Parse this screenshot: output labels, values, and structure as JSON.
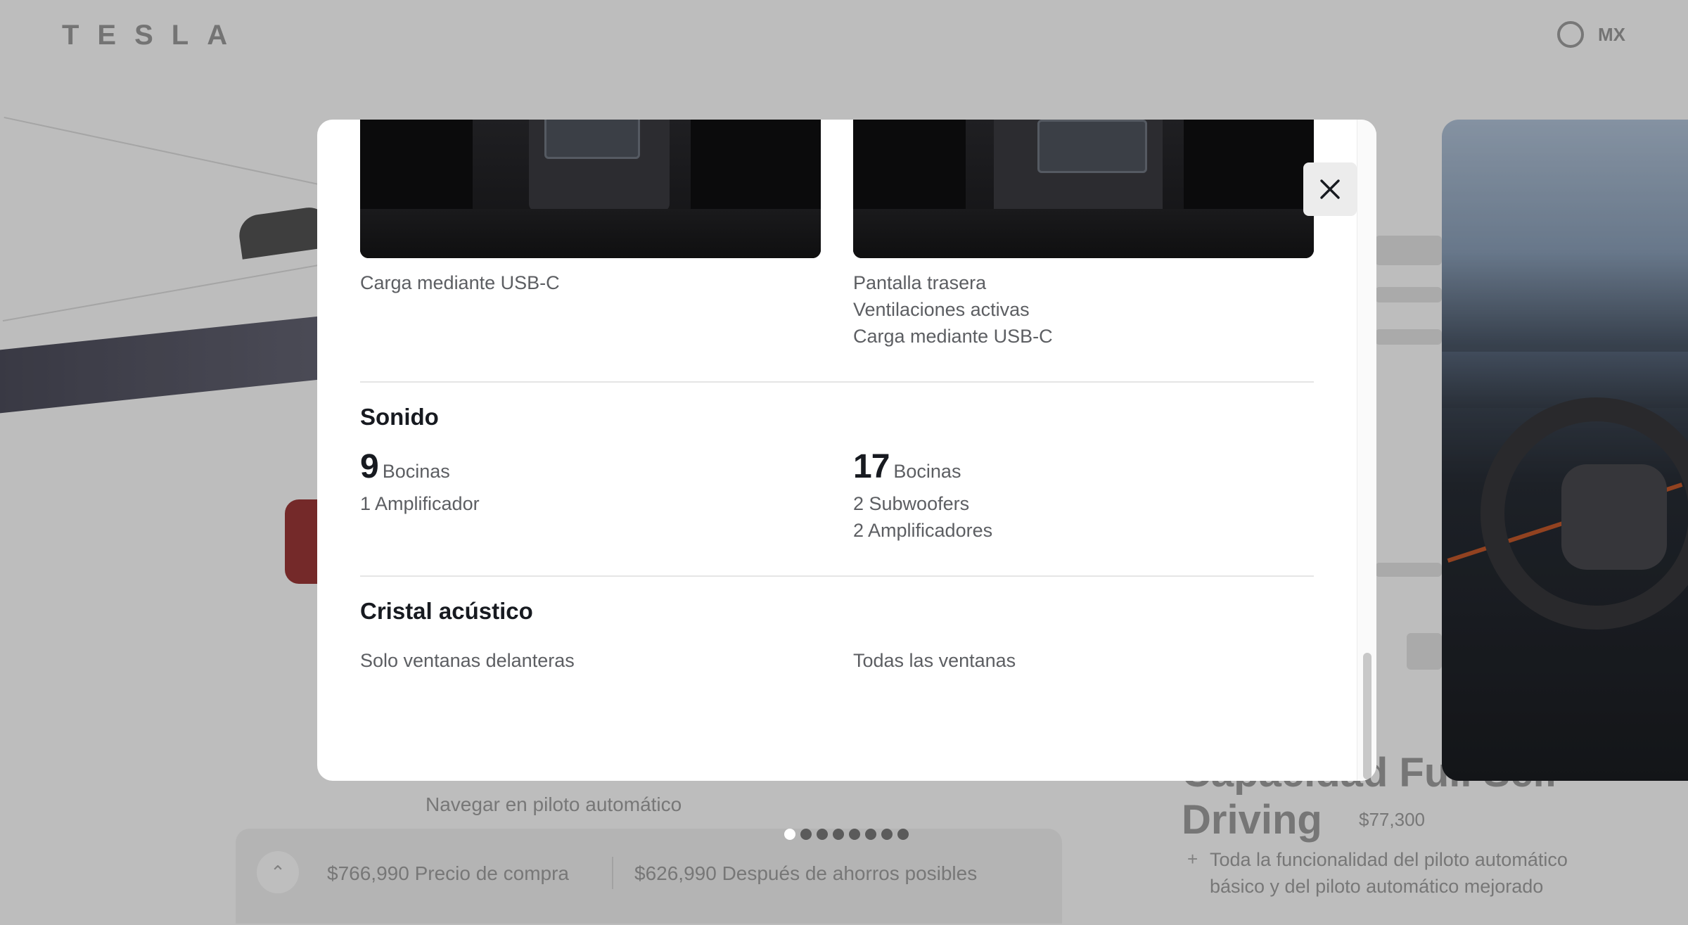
{
  "header": {
    "logo_text": "TESLA",
    "language": "MX"
  },
  "background": {
    "caption": "Navegar en piloto automático",
    "price_purchase": "$766,990 Precio de compra",
    "price_savings": "$626,990 Después de ahorros posibles",
    "right_heading": "Capacidad Full Self-Driving",
    "right_price": "$77,300",
    "right_bullet": "Toda la funcionalidad del piloto automático básico y del piloto automático mejorado"
  },
  "carousel": {
    "dot_count": 8,
    "active_index": 0
  },
  "modal": {
    "top_left_caption": "Carga mediante USB-C",
    "top_right_lines": [
      "Pantalla trasera",
      "Ventilaciones activas",
      "Carga mediante USB-C"
    ],
    "sound": {
      "title": "Sonido",
      "left": {
        "number": "9",
        "unit": "Bocinas",
        "lines": [
          "1 Amplificador"
        ]
      },
      "right": {
        "number": "17",
        "unit": "Bocinas",
        "lines": [
          "2 Subwoofers",
          "2 Amplificadores"
        ]
      }
    },
    "glass": {
      "title": "Cristal acústico",
      "left": "Solo ventanas delanteras",
      "right": "Todas las ventanas"
    },
    "close_icon": "close-icon"
  }
}
